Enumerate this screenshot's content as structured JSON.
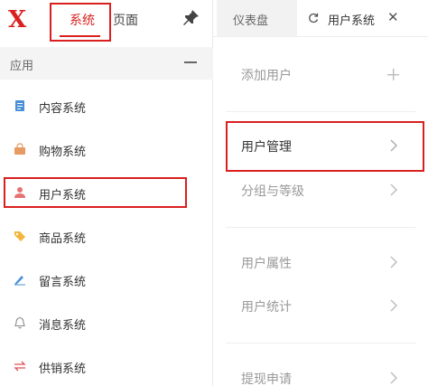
{
  "brand": {
    "logo_letter": "X",
    "accent_color": "#d9201f"
  },
  "left": {
    "tabs": [
      {
        "label": "系统",
        "active": true
      },
      {
        "label": "页面",
        "active": false
      }
    ],
    "pin_icon": "pin-icon",
    "section": {
      "title": "应用",
      "collapse_icon": "minus-icon"
    },
    "items": [
      {
        "label": "内容系统",
        "icon": "document-icon",
        "icon_color": "#4a90d9"
      },
      {
        "label": "购物系统",
        "icon": "shopping-bag-icon",
        "icon_color": "#e89a63"
      },
      {
        "label": "用户系统",
        "icon": "user-icon",
        "icon_color": "#e57373",
        "active": true
      },
      {
        "label": "商品系统",
        "icon": "tag-icon",
        "icon_color": "#f2b63c"
      },
      {
        "label": "留言系统",
        "icon": "pen-icon",
        "icon_color": "#4a90d9"
      },
      {
        "label": "消息系统",
        "icon": "bell-icon",
        "icon_color": "#888888"
      },
      {
        "label": "供销系统",
        "icon": "exchange-icon",
        "icon_color": "#e05050"
      }
    ]
  },
  "right": {
    "tabs": [
      {
        "label": "仪表盘",
        "active": false
      },
      {
        "label": "用户系统",
        "active": true,
        "refresh_icon": "refresh-icon",
        "close_icon": "close-icon",
        "close_glyph": "✕"
      }
    ],
    "items": [
      {
        "label": "添加用户",
        "trailing": "plus"
      },
      {
        "label": "用户管理",
        "trailing": "chevron",
        "highlighted": true
      },
      {
        "label": "分组与等级",
        "trailing": "chevron"
      },
      {
        "label": "用户属性",
        "trailing": "chevron"
      },
      {
        "label": "用户统计",
        "trailing": "chevron"
      },
      {
        "label": "提现申请",
        "trailing": "chevron"
      }
    ]
  }
}
